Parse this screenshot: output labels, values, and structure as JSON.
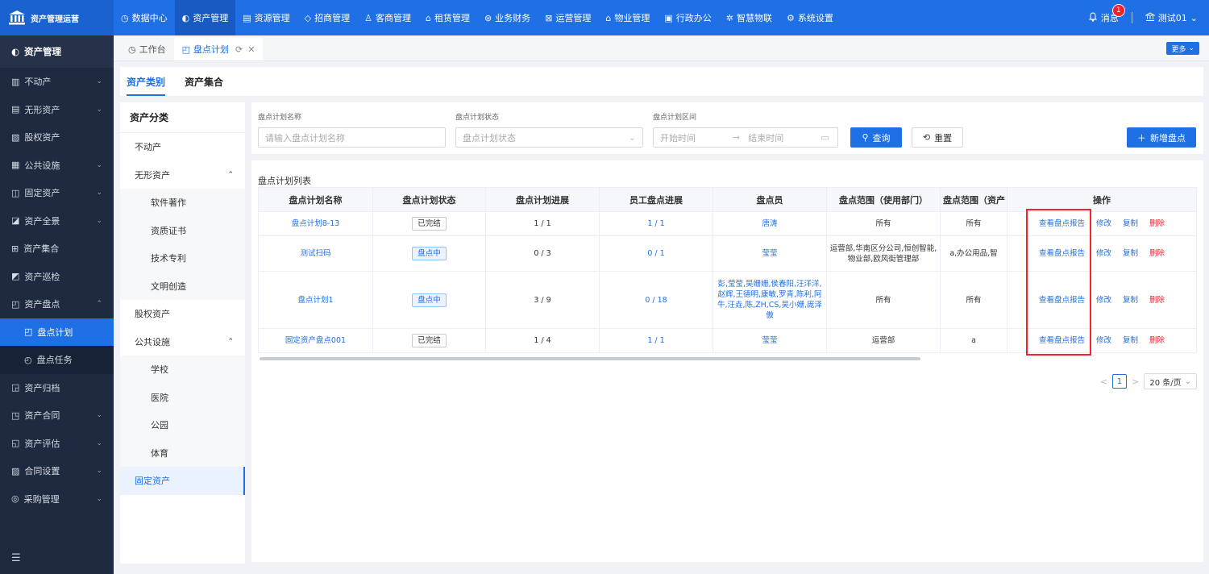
{
  "app": {
    "name": "资产管理运营"
  },
  "topnav": [
    {
      "icon": "◷",
      "label": "数据中心",
      "active": false
    },
    {
      "icon": "◐",
      "label": "资产管理",
      "active": true
    },
    {
      "icon": "▤",
      "label": "资源管理",
      "active": false
    },
    {
      "icon": "◇",
      "label": "招商管理",
      "active": false
    },
    {
      "icon": "♙",
      "label": "客商管理",
      "active": false
    },
    {
      "icon": "⌂",
      "label": "租赁管理",
      "active": false
    },
    {
      "icon": "⊛",
      "label": "业务财务",
      "active": false
    },
    {
      "icon": "⊠",
      "label": "运营管理",
      "active": false
    },
    {
      "icon": "⌂",
      "label": "物业管理",
      "active": false
    },
    {
      "icon": "▣",
      "label": "行政办公",
      "active": false
    },
    {
      "icon": "✲",
      "label": "智慧物联",
      "active": false
    },
    {
      "icon": "⚙",
      "label": "系统设置",
      "active": false
    }
  ],
  "topright": {
    "messages_label": "消息",
    "messages_count": "1",
    "user": "测试01"
  },
  "sidebar": {
    "title": "资产管理",
    "items": [
      {
        "icon": "▥",
        "label": "不动产",
        "chevron": "⌄"
      },
      {
        "icon": "▤",
        "label": "无形资产",
        "chevron": "⌄"
      },
      {
        "icon": "▧",
        "label": "股权资产",
        "chevron": ""
      },
      {
        "icon": "▦",
        "label": "公共设施",
        "chevron": "⌄"
      },
      {
        "icon": "◫",
        "label": "固定资产",
        "chevron": "⌄"
      },
      {
        "icon": "◪",
        "label": "资产全景",
        "chevron": "⌄"
      },
      {
        "icon": "⊞",
        "label": "资产集合",
        "chevron": ""
      },
      {
        "icon": "◩",
        "label": "资产巡检",
        "chevron": ""
      },
      {
        "icon": "◰",
        "label": "资产盘点",
        "chevron": "⌃"
      }
    ],
    "sub_items": [
      {
        "icon": "◰",
        "label": "盘点计划",
        "active": true
      },
      {
        "icon": "◴",
        "label": "盘点任务",
        "active": false
      }
    ],
    "items_after": [
      {
        "icon": "◲",
        "label": "资产归档",
        "chevron": ""
      },
      {
        "icon": "◳",
        "label": "资产合同",
        "chevron": "⌄"
      },
      {
        "icon": "◱",
        "label": "资产评估",
        "chevron": "⌄"
      },
      {
        "icon": "▨",
        "label": "合同设置",
        "chevron": "⌄"
      },
      {
        "icon": "◎",
        "label": "采购管理",
        "chevron": "⌄"
      }
    ],
    "collapse_icon": "☰"
  },
  "tabs": [
    {
      "icon": "◷",
      "label": "工作台",
      "active": false
    },
    {
      "icon": "◰",
      "label": "盘点计划",
      "active": true
    }
  ],
  "more_label": "更多",
  "subtabs": [
    {
      "label": "资产类别",
      "active": true
    },
    {
      "label": "资产集合",
      "active": false
    }
  ],
  "categories": {
    "title": "资产分类",
    "items": [
      {
        "label": "不动产",
        "type": "top",
        "chevron": ""
      },
      {
        "label": "无形资产",
        "type": "top",
        "chevron": "⌃"
      },
      {
        "label": "软件著作",
        "type": "child"
      },
      {
        "label": "资质证书",
        "type": "child"
      },
      {
        "label": "技术专利",
        "type": "child"
      },
      {
        "label": "文明创造",
        "type": "child"
      },
      {
        "label": "股权资产",
        "type": "top",
        "chevron": ""
      },
      {
        "label": "公共设施",
        "type": "top",
        "chevron": "⌃"
      },
      {
        "label": "学校",
        "type": "child"
      },
      {
        "label": "医院",
        "type": "child"
      },
      {
        "label": "公园",
        "type": "child"
      },
      {
        "label": "体育",
        "type": "child"
      },
      {
        "label": "固定资产",
        "type": "top",
        "chevron": "",
        "active": true
      }
    ]
  },
  "filters": {
    "name_label": "盘点计划名称",
    "name_placeholder": "请输入盘点计划名称",
    "status_label": "盘点计划状态",
    "status_placeholder": "盘点计划状态",
    "range_label": "盘点计划区间",
    "start_placeholder": "开始时间",
    "range_sep": "→",
    "end_placeholder": "结束时间",
    "search_label": "查询",
    "reset_label": "重置",
    "add_label": "新增盘点"
  },
  "table": {
    "title": "盘点计划列表",
    "headers": [
      "盘点计划名称",
      "盘点计划状态",
      "盘点计划进展",
      "员工盘点进展",
      "盘点员",
      "盘点范围（使用部门）",
      "盘点范围（资产",
      "操作"
    ],
    "rows": [
      {
        "name": "盘点计划8-13",
        "status": "已完结",
        "status_type": "done",
        "plan_progress": "1 / 1",
        "staff_progress": "1 / 1",
        "checker": "唐涛",
        "dept_scope": "所有",
        "asset_scope": "所有"
      },
      {
        "name": "测试扫码",
        "status": "盘点中",
        "status_type": "doing",
        "plan_progress": "0 / 3",
        "staff_progress": "0 / 1",
        "checker": "莹莹",
        "dept_scope": "运营部,华南区分公司,恒创智能,物业部,欧风街管理部",
        "asset_scope": "a,办公用品,智"
      },
      {
        "name": "盘点计划1",
        "status": "盘点中",
        "status_type": "doing",
        "plan_progress": "3 / 9",
        "staff_progress": "0 / 18",
        "checker": "彭,莹莹,吴姗姗,侯春阳,汪洋洋,赵辉,王德明,康敏,罗青,陈利,阿牛,汪垚,陈,ZH,CS,吴小姗,庞泽傲",
        "dept_scope": "所有",
        "asset_scope": "所有"
      },
      {
        "name": "固定资产盘点001",
        "status": "已完结",
        "status_type": "done",
        "plan_progress": "1 / 4",
        "staff_progress": "1 / 1",
        "checker": "莹莹",
        "dept_scope": "运营部",
        "asset_scope": "a"
      }
    ],
    "ops": {
      "view_report": "查看盘点报告",
      "edit": "修改",
      "copy": "复制",
      "delete": "删除"
    }
  },
  "pager": {
    "prev": "<",
    "page": "1",
    "next": ">",
    "page_size": "20 条/页"
  },
  "colors": {
    "primary": "#1f6fe5",
    "sidebar_bg": "#1e2a3f",
    "danger": "#f5222d"
  }
}
